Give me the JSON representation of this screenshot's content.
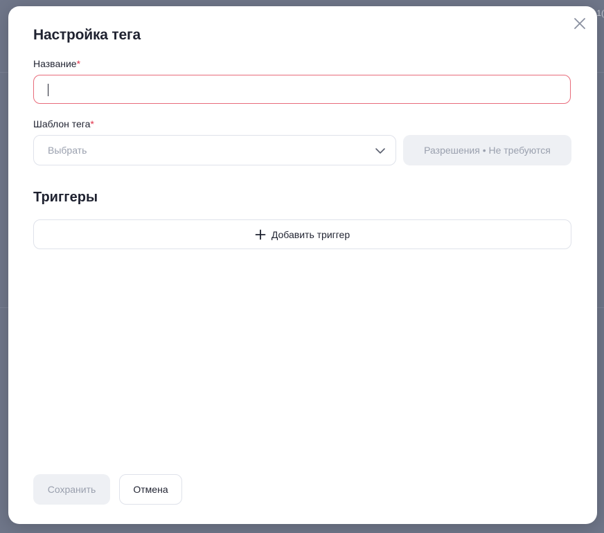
{
  "backdrop": {
    "edge_text": "1("
  },
  "modal": {
    "title": "Настройка тега",
    "close_icon": "close-icon"
  },
  "name_field": {
    "label": "Название",
    "required_mark": "*",
    "value": "",
    "state": "error"
  },
  "template_field": {
    "label": "Шаблон тега",
    "required_mark": "*",
    "selected": "Выбрать",
    "icon": "chevron-down-icon"
  },
  "permissions": {
    "label": "Разрешения • Не требуются"
  },
  "triggers": {
    "title": "Триггеры",
    "add_label": "Добавить триггер",
    "add_icon": "plus-icon"
  },
  "footer": {
    "save_label": "Сохранить",
    "cancel_label": "Отмена"
  },
  "colors": {
    "accent_error": "#e86b7a",
    "required_mark": "#e0324a",
    "disabled_bg": "#eef0f4",
    "backdrop": "#6f7689"
  }
}
